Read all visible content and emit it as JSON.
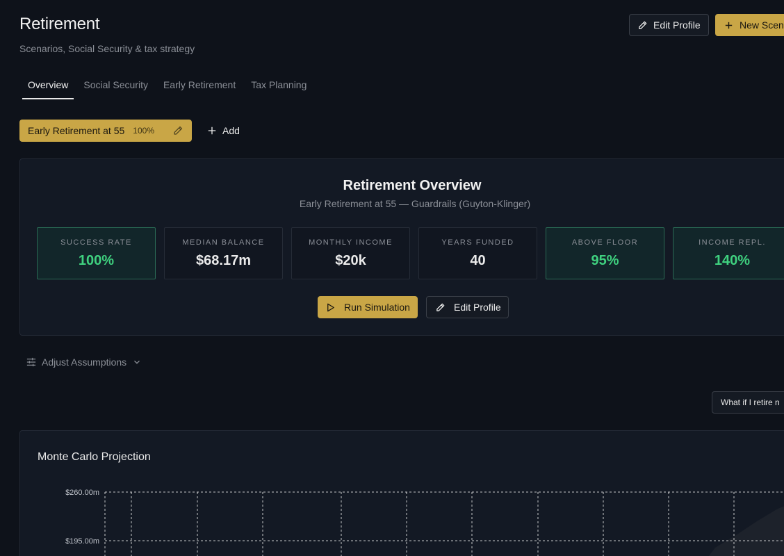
{
  "header": {
    "title": "Retirement",
    "subtitle": "Scenarios, Social Security & tax strategy",
    "edit_profile_label": "Edit Profile",
    "new_scenario_label": "New Scen"
  },
  "tabs": [
    {
      "label": "Overview",
      "active": true
    },
    {
      "label": "Social Security",
      "active": false
    },
    {
      "label": "Early Retirement",
      "active": false
    },
    {
      "label": "Tax Planning",
      "active": false
    }
  ],
  "scenario_chip": {
    "name": "Early Retirement at 55",
    "percent": "100%"
  },
  "add_label": "Add",
  "overview": {
    "title": "Retirement Overview",
    "subtitle": "Early Retirement at 55 — Guardrails (Guyton-Klinger)",
    "stats": [
      {
        "label": "SUCCESS RATE",
        "value": "100%",
        "tone": "good"
      },
      {
        "label": "MEDIAN BALANCE",
        "value": "$68.17m",
        "tone": "neutral"
      },
      {
        "label": "MONTHLY INCOME",
        "value": "$20k",
        "tone": "neutral"
      },
      {
        "label": "YEARS FUNDED",
        "value": "40",
        "tone": "neutral"
      },
      {
        "label": "ABOVE FLOOR",
        "value": "95%",
        "tone": "good"
      },
      {
        "label": "INCOME REPL.",
        "value": "140%",
        "tone": "good"
      }
    ],
    "run_label": "Run Simulation",
    "edit_label": "Edit Profile"
  },
  "adjust_label": "Adjust Assumptions",
  "whatif_label": "What if I retire n",
  "monte_carlo": {
    "title": "Monte Carlo Projection"
  },
  "chart_data": {
    "type": "area",
    "title": "Monte Carlo Projection",
    "y_tick_labels": [
      "$260.00m",
      "$195.00m"
    ],
    "y_ticks": [
      260,
      195
    ],
    "grid": true,
    "x_gridlines": 11
  },
  "colors": {
    "accent": "#c9a646",
    "good": "#3fd17f",
    "background": "#0e121a",
    "card": "#131924"
  }
}
